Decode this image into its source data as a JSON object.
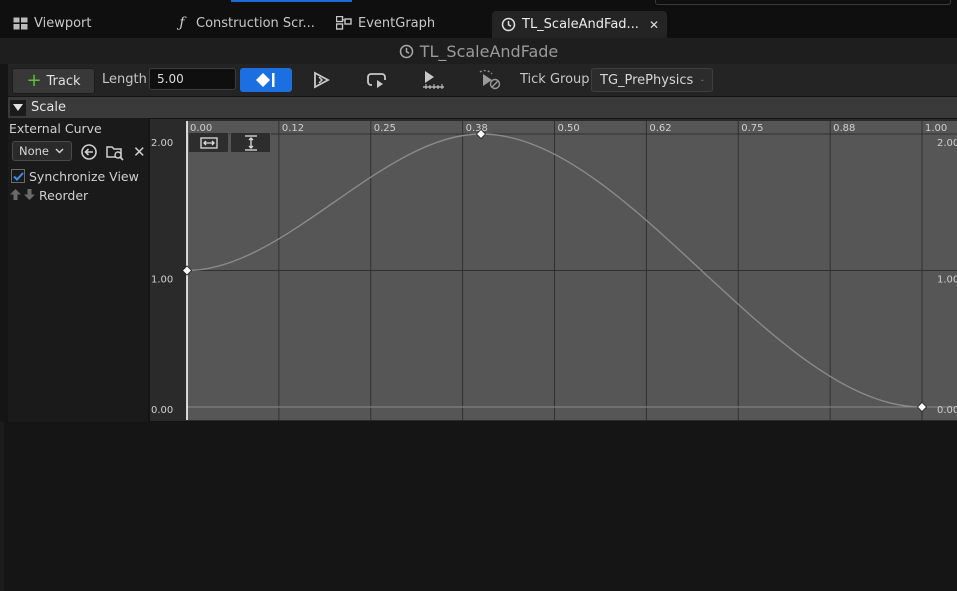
{
  "tabs": [
    {
      "label": "Viewport",
      "icon": "viewport-icon"
    },
    {
      "label": "Construction Scr...",
      "icon": "function-icon"
    },
    {
      "label": "EventGraph",
      "icon": "event-graph-icon"
    },
    {
      "label": "TL_ScaleAndFad...",
      "icon": "timeline-icon",
      "active": true
    }
  ],
  "title": "TL_ScaleAndFade",
  "toolbar": {
    "track_label": "Track",
    "length_label": "Length",
    "length_value": "5.00",
    "tick_group_label": "Tick Group",
    "tick_group_value": "TG_PrePhysics"
  },
  "track": {
    "name": "Scale",
    "external_curve_label": "External Curve",
    "external_curve_value": "None",
    "sync_view_label": "Synchronize View",
    "sync_view_checked": true,
    "reorder_label": "Reorder"
  },
  "curve_editor": {
    "x_ticks": [
      "0.00",
      "0.12",
      "0.25",
      "0.38",
      "0.50",
      "0.62",
      "0.75",
      "0.88",
      "1.00"
    ],
    "y_ticks_left": [
      "2.00",
      "1.00",
      "0.00"
    ],
    "y_ticks_right": [
      "2.00",
      "1.00",
      "0.00"
    ],
    "keys": [
      {
        "time": 0.0,
        "value": 1.0
      },
      {
        "time": 0.4,
        "value": 2.0
      },
      {
        "time": 1.0,
        "value": 0.0
      }
    ]
  },
  "colors": {
    "accent": "#1b6fe0",
    "curve": "#8a8a8a",
    "graph_bg": "#565656"
  }
}
